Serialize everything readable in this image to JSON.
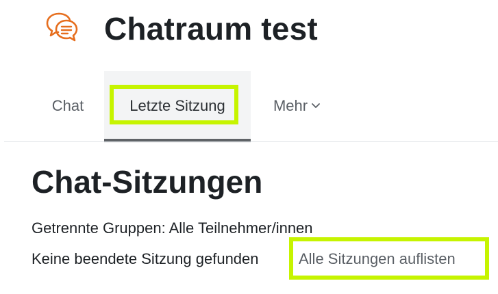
{
  "header": {
    "title": "Chatraum test",
    "icon": "chat-bubbles-icon",
    "icon_color": "#e66e1e"
  },
  "tabs": [
    {
      "label": "Chat",
      "active": false
    },
    {
      "label": "Letzte Sitzung",
      "active": true
    },
    {
      "label": "Mehr",
      "active": false,
      "has_dropdown": true
    }
  ],
  "content": {
    "heading": "Chat-Sitzungen",
    "group_info": "Getrennte Gruppen: Alle Teilnehmer/innen",
    "no_sessions": "Keine beendete Sitzung gefunden",
    "list_all_link": "Alle Sitzungen auflisten"
  },
  "highlight": {
    "color": "#c6f400"
  }
}
